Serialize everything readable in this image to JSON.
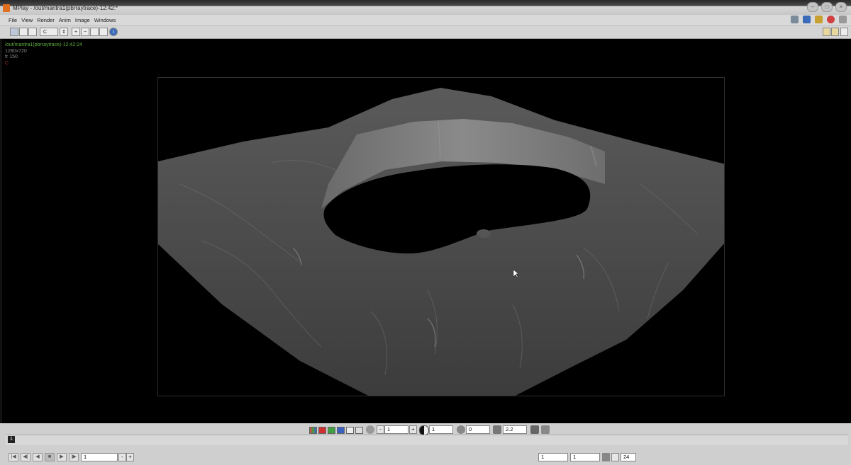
{
  "window": {
    "title": "MPlay - /out/mantra1(pbrraytrace)-12:42:*",
    "buttons": [
      "–",
      "□",
      "×"
    ]
  },
  "menu": {
    "items": [
      "File",
      "View",
      "Render",
      "Anim",
      "Image",
      "Windows"
    ]
  },
  "toolbar": {
    "channel_value": "C",
    "channel_arrow": "⇕",
    "zoom_in": "+",
    "zoom_out": "−",
    "info_icon": "i"
  },
  "image_info": {
    "path": "/out/mantra1(pbrraytrace)-12:42:24",
    "resolution": "1280x720",
    "frame": "fr 150",
    "channel": "C"
  },
  "bottom_controls": {
    "minus": "-",
    "plus": "+",
    "exposure_value": "1",
    "gamma_label_value": "1",
    "offset_value": "0",
    "gamma_value": "2.2"
  },
  "timeline": {
    "current_marker": "1",
    "frame_field": "1",
    "range_start": "1",
    "range_end": "1",
    "fps": "24"
  },
  "colors": {
    "accent_orange": "#e07020",
    "path_green": "#5fae3e",
    "channel_red": "#b03030"
  }
}
